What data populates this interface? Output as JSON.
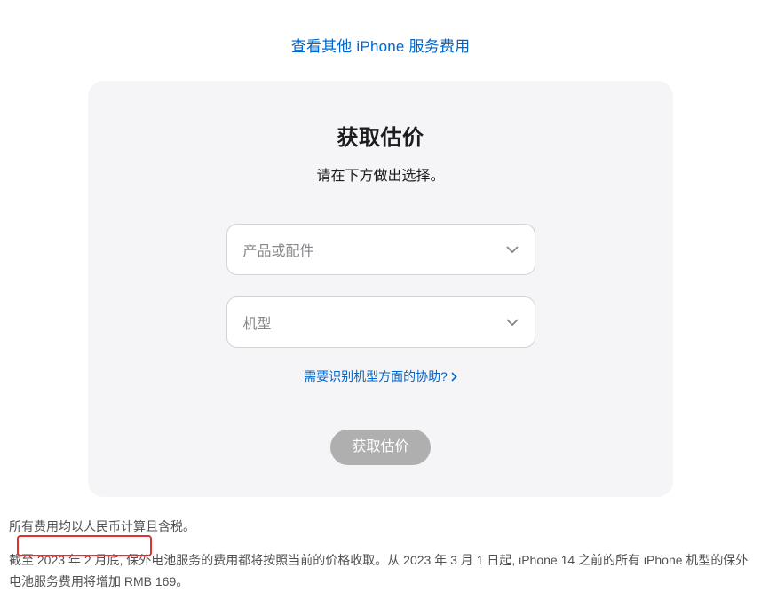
{
  "topLink": {
    "label": "查看其他 iPhone 服务费用"
  },
  "card": {
    "title": "获取估价",
    "subtitle": "请在下方做出选择。",
    "selects": {
      "product": {
        "placeholder": "产品或配件"
      },
      "model": {
        "placeholder": "机型"
      }
    },
    "helpLink": {
      "label": "需要识别机型方面的协助?"
    },
    "button": {
      "label": "获取估价"
    }
  },
  "footer": {
    "line1": "所有费用均以人民币计算且含税。",
    "line2": "截至 2023 年 2 月底, 保外电池服务的费用都将按照当前的价格收取。从 2023 年 3 月 1 日起, iPhone 14 之前的所有 iPhone 机型的保外电池服务费用将增加 RMB 169。"
  }
}
